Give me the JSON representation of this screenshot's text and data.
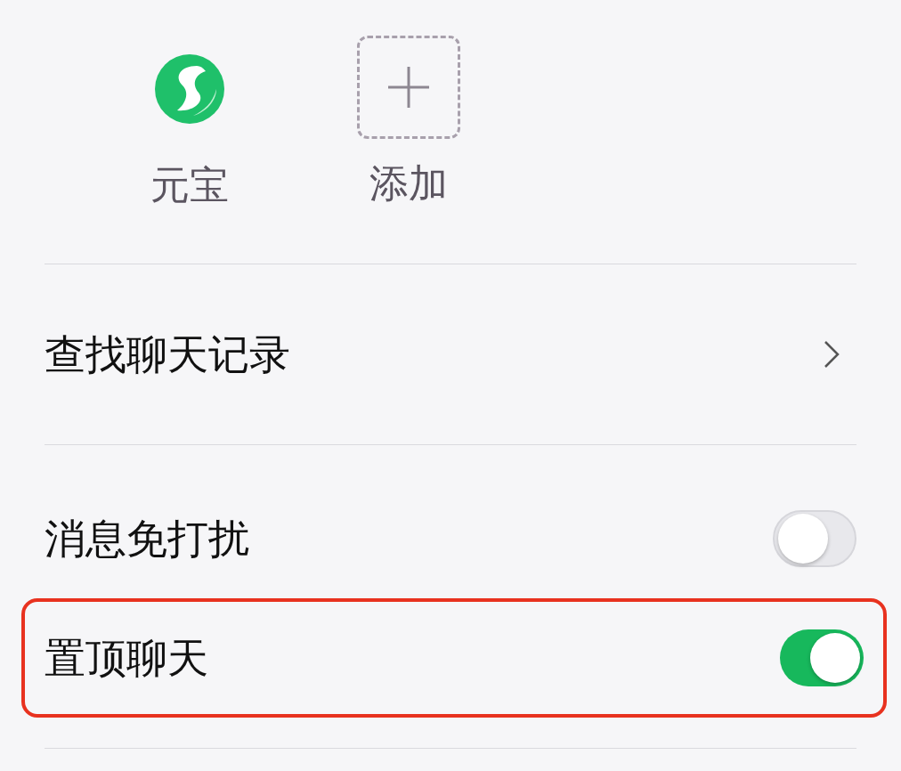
{
  "members": [
    {
      "name": "元宝",
      "kind": "avatar"
    },
    {
      "name": "添加",
      "kind": "add"
    }
  ],
  "rows": [
    {
      "label": "查找聊天记录",
      "kind": "link",
      "highlighted": false
    },
    {
      "label": "消息免打扰",
      "kind": "switch",
      "on": false,
      "highlighted": false
    },
    {
      "label": "置顶聊天",
      "kind": "switch",
      "on": true,
      "highlighted": true
    }
  ]
}
